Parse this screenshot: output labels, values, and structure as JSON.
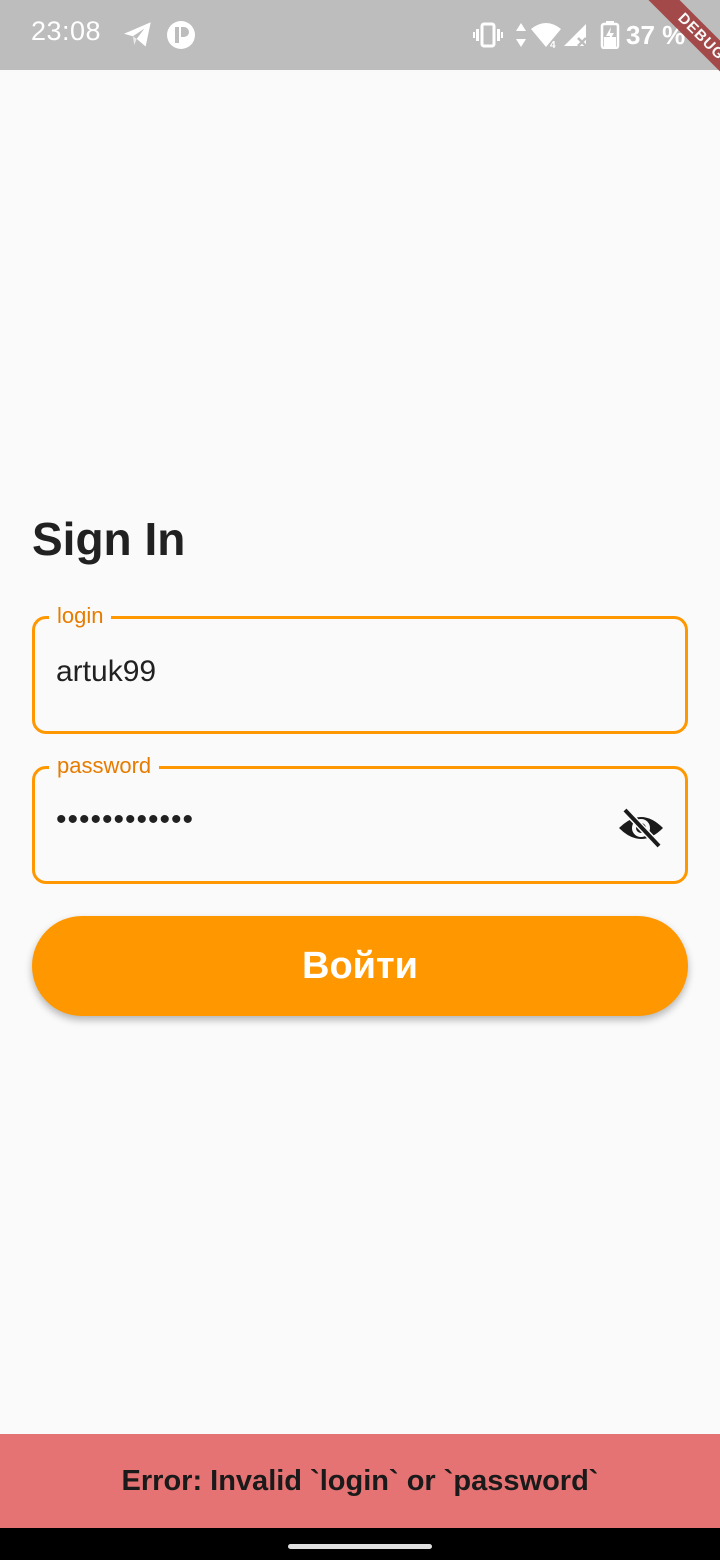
{
  "status_bar": {
    "time": "23:08",
    "battery_level": "37 %",
    "icons": [
      "telegram-icon",
      "app-icon",
      "vibrate-icon",
      "data-icon",
      "wifi-icon",
      "signal-icon",
      "battery-icon"
    ]
  },
  "debug_banner": "DEBUG",
  "sign_in": {
    "title": "Sign In",
    "login": {
      "label": "login",
      "value": "artuk99"
    },
    "password": {
      "label": "password",
      "value": "••••••••••••",
      "toggle_icon": "visibility-off-icon"
    },
    "submit_label": "Войти"
  },
  "error_message": "Error: Invalid `login` or `password`",
  "colors": {
    "accent": "#ff9800",
    "label": "#e67c00",
    "error_background": "#e57373",
    "status_bar": "#bdbdbd",
    "background": "#fafafa"
  }
}
